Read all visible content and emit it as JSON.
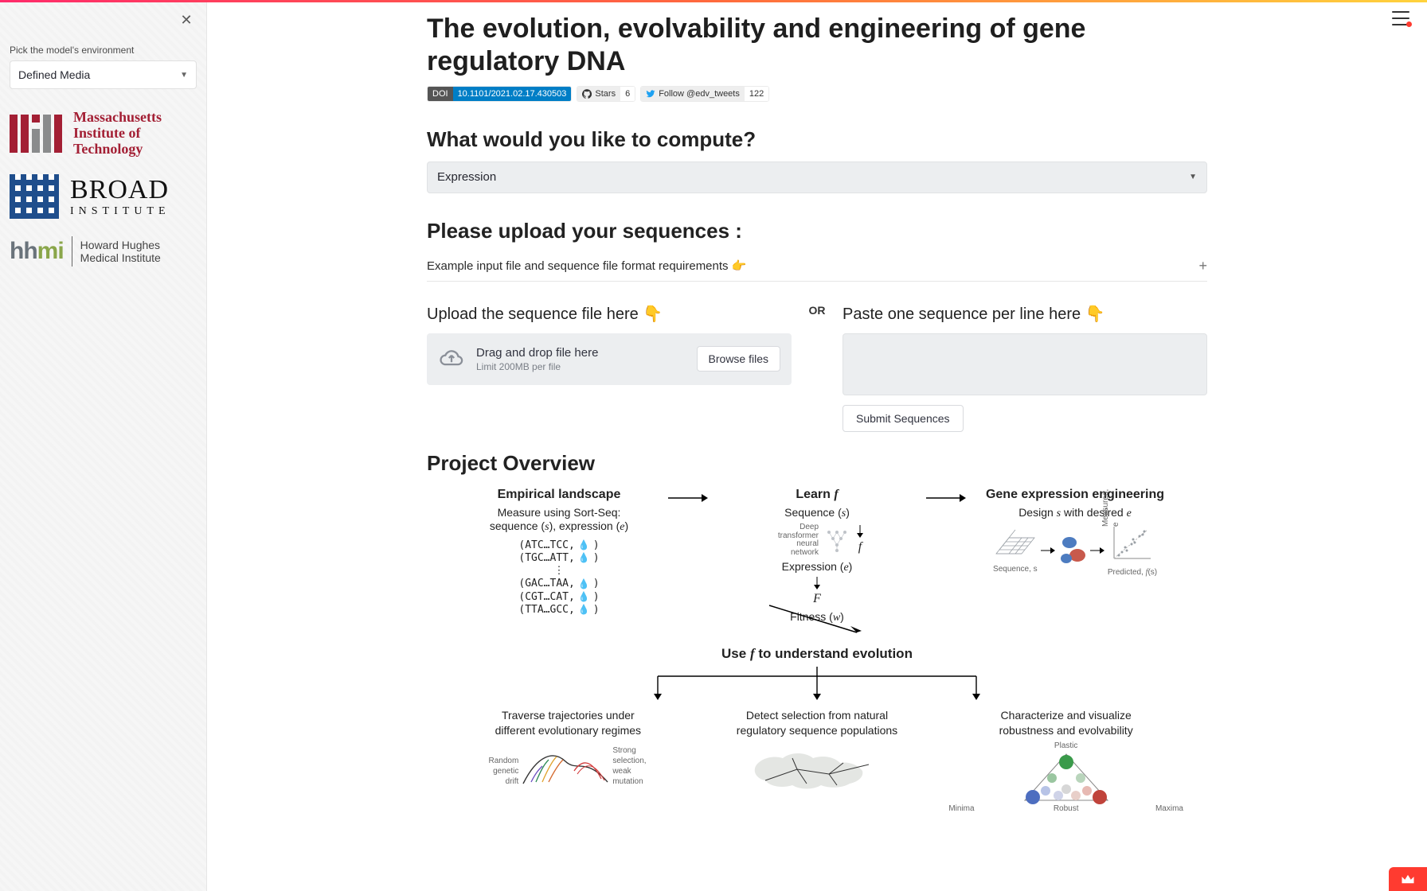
{
  "sidebar": {
    "env_label": "Pick the model's environment",
    "env_value": "Defined Media",
    "logos": {
      "mit": "Massachusetts Institute of Technology",
      "broad_big": "BROAD",
      "broad_small": "INSTITUTE",
      "hhmi_mark": "hhmi",
      "hhmi_text_l1": "Howard Hughes",
      "hhmi_text_l2": "Medical Institute"
    }
  },
  "header": {
    "title": "The evolution, evolvability and engineering of gene regulatory DNA"
  },
  "badges": {
    "doi_label": "DOI",
    "doi_value": "10.1101/2021.02.17.430503",
    "gh_label": "Stars",
    "gh_count": "6",
    "tw_label": "Follow @edv_tweets",
    "tw_count": "122"
  },
  "compute": {
    "heading": "What would you like to compute?",
    "value": "Expression"
  },
  "upload": {
    "heading": "Please upload your sequences :",
    "expander": "Example input file and sequence file format requirements 👉",
    "left_head": "Upload the sequence file here 👇",
    "dz_line1": "Drag and drop file here",
    "dz_line2": "Limit 200MB per file",
    "browse": "Browse files",
    "or": "OR",
    "right_head": "Paste one sequence per line here 👇",
    "paste_placeholder": "",
    "submit": "Submit Sequences"
  },
  "overview": {
    "heading": "Project Overview",
    "panel_a_title": "Empirical landscape",
    "panel_a_sub_pre": "Measure using Sort-Seq:",
    "panel_a_sub_seq": "sequence (",
    "panel_a_sub_s": "s",
    "panel_a_sub_mid": "), expression (",
    "panel_a_sub_e": "e",
    "panel_a_sub_end": ")",
    "seq1": "(ATC…TCC,",
    "seq2": "(TGC…ATT,",
    "seq3": "(GAC…TAA,",
    "seq4": "(CGT…CAT,",
    "seq5": "(TTA…GCC,",
    "dots": "⋮",
    "panel_b_title_pre": "Learn ",
    "panel_b_title_f": "f",
    "panel_b_nn_l1": "Deep",
    "panel_b_nn_l2": "transformer",
    "panel_b_nn_l3": "neural network",
    "panel_b_seq_pre": "Sequence (",
    "panel_b_seq_s": "s",
    "panel_b_seq_end": ")",
    "panel_b_f": "f",
    "panel_b_expr_pre": "Expression (",
    "panel_b_expr_e": "e",
    "panel_b_expr_end": ")",
    "panel_b_F": "F",
    "panel_b_fit_pre": "Fitness (",
    "panel_b_fit_w": "w",
    "panel_b_fit_end": ")",
    "panel_c_title": "Gene expression engineering",
    "panel_c_sub_pre": "Design ",
    "panel_c_sub_s": "s",
    "panel_c_sub_mid": " with desired ",
    "panel_c_sub_e": "e",
    "panel_c_ax_y": "Measured, e",
    "panel_c_ax_x_pre": "Predicted, ",
    "panel_c_ax_x_f": "f",
    "panel_c_ax_x_end": "(s)",
    "panel_c_seq_lbl": "Sequence, s",
    "mid_title_pre": "Use ",
    "mid_title_f": "f",
    "mid_title_post": " to understand evolution",
    "bot1_l1": "Traverse trajectories under",
    "bot1_l2": "different evolutionary regimes",
    "bot1_left": "Random genetic drift",
    "bot1_right": "Strong selection, weak mutation",
    "bot2_l1": "Detect selection from natural",
    "bot2_l2": "regulatory sequence populations",
    "bot3_l1": "Characterize and visualize",
    "bot3_l2": "robustness and evolvability",
    "bot3_top": "Plastic",
    "bot3_left": "Minima",
    "bot3_right": "Maxima",
    "bot3_bottom": "Robust"
  }
}
